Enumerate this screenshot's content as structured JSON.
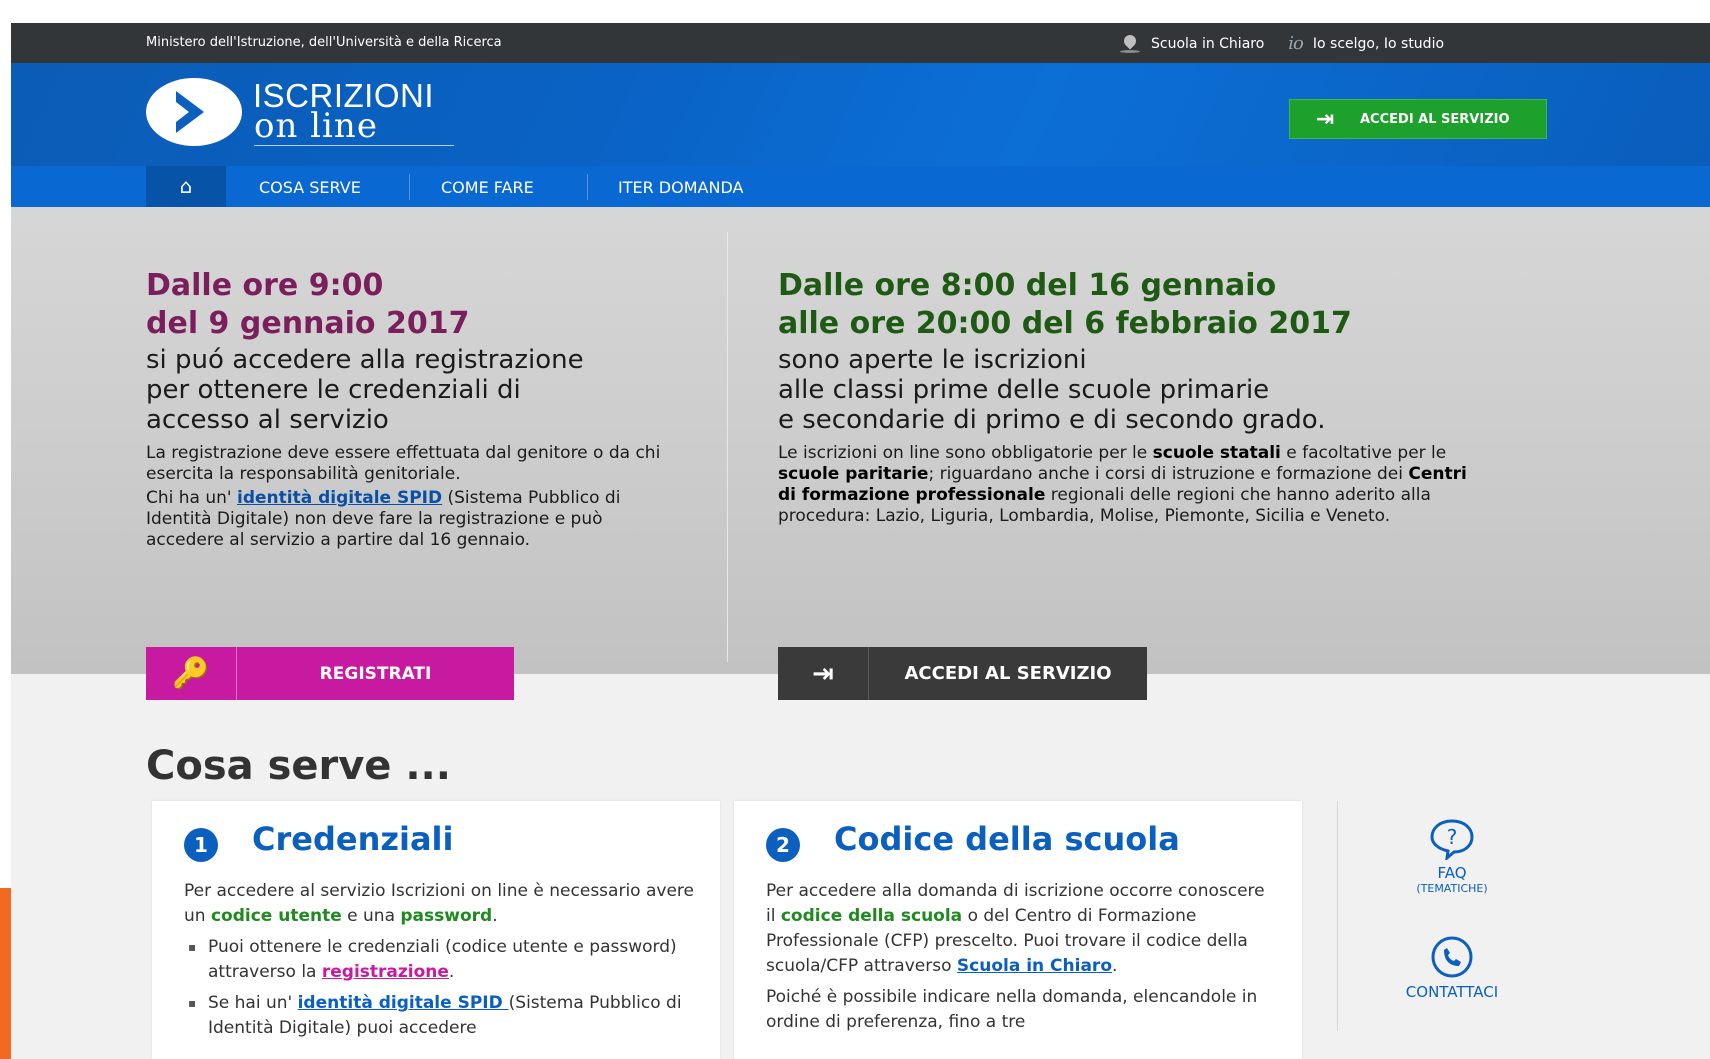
{
  "topbar": {
    "ministry": "Ministero dell'Istruzione, dell'Università e della Ricerca",
    "scuola_in_chiaro": "Scuola in Chiaro",
    "io_logo": "io",
    "io_scelgo": "Io scelgo, Io studio"
  },
  "header": {
    "logo_line1": "ISCRIZIONI",
    "logo_line2": "on line",
    "accedi_button": "ACCEDI AL SERVIZIO"
  },
  "nav": {
    "items": [
      "COSA SERVE",
      "COME FARE",
      "ITER DOMANDA"
    ]
  },
  "hero": {
    "left": {
      "title1": "Dalle ore 9:00",
      "title2": "del 9 gennaio 2017",
      "sub1": "si puó accedere alla registrazione",
      "sub2": "per ottenere le credenziali di",
      "sub3": "accesso al servizio",
      "p1": "La registrazione deve essere effettuata dal genitore o da chi esercita la responsabilità genitoriale.",
      "p2_pre": "Chi ha un' ",
      "p2_link": "identità digitale SPID",
      "p2_post": " (Sistema Pubblico di Identità Digitale) non deve fare la registrazione e può accedere al servizio a partire dal 16 gennaio.",
      "button": "REGISTRATI"
    },
    "right": {
      "title1": "Dalle ore 8:00 del 16 gennaio",
      "title2": "alle ore 20:00 del 6 febbraio 2017",
      "sub1": "sono aperte le iscrizioni",
      "sub2": "alle classi prime delle scuole primarie",
      "sub3": "e secondarie di primo e di secondo grado.",
      "p_a": "Le iscrizioni on line sono obbligatorie per le ",
      "p_b": "scuole statali",
      "p_c": " e facoltative per le ",
      "p_d": "scuole paritarie",
      "p_e": "; riguardano anche i corsi di istruzione e formazione dei ",
      "p_f": "Centri di formazione professionale",
      "p_g": " regionali delle regioni che hanno aderito alla procedura: Lazio, Liguria, Lombardia, Molise, Piemonte, Sicilia e Veneto.",
      "button": "ACCEDI AL SERVIZIO"
    }
  },
  "cosa_serve": {
    "title": "Cosa serve ...",
    "card1": {
      "num": "1",
      "title": "Credenziali",
      "p_a": "Per accedere al servizio Iscrizioni on line è necessario avere un ",
      "p_b": "codice utente",
      "p_c": " e una ",
      "p_d": "password",
      "p_e": ".",
      "li1_a": "Puoi ottenere le credenziali (codice utente e password) attraverso la ",
      "li1_b": "registrazione",
      "li1_c": ".",
      "li2_a": "Se hai un' ",
      "li2_b": "identità digitale SPID ",
      "li2_c": "(Sistema Pubblico di Identità Digitale) puoi accedere"
    },
    "card2": {
      "num": "2",
      "title": "Codice della scuola",
      "p_a": "Per accedere alla domanda di iscrizione occorre conoscere il ",
      "p_b": "codice della scuola",
      "p_c": " o del Centro di Formazione Professionale (CFP) prescelto. Puoi trovare il codice della scuola/CFP attraverso ",
      "p_d": "Scuola in Chiaro",
      "p_e": ".",
      "p2": "Poiché è possibile indicare nella domanda, elencandole in ordine di preferenza, fino a tre"
    },
    "faq": {
      "label": "FAQ",
      "sub": "(TEMATICHE)"
    },
    "contattaci": {
      "label": "CONTATTACI"
    }
  },
  "colors": {
    "header_blue": "#0a62c4",
    "nav_blue": "#0a68d2",
    "green": "#1ea02d",
    "magenta": "#c71aa0",
    "title_left": "#7a1f5c",
    "title_right": "#1f5a14"
  }
}
